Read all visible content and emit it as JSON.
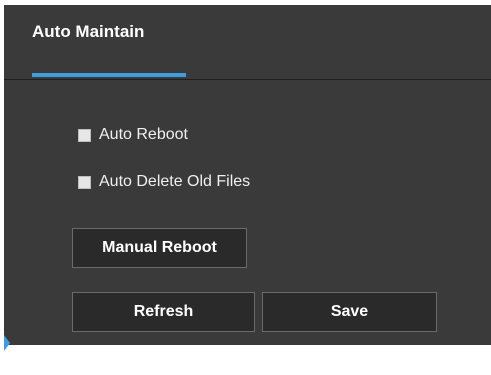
{
  "header": {
    "title": "Auto Maintain"
  },
  "options": {
    "auto_reboot": {
      "label": "Auto Reboot",
      "checked": false
    },
    "auto_delete": {
      "label": "Auto Delete Old Files",
      "checked": false
    }
  },
  "buttons": {
    "manual_reboot": "Manual Reboot",
    "refresh": "Refresh",
    "save": "Save"
  },
  "colors": {
    "panel_bg": "#3a3a3a",
    "accent": "#3c9de0",
    "button_bg": "#2a2a2a"
  }
}
